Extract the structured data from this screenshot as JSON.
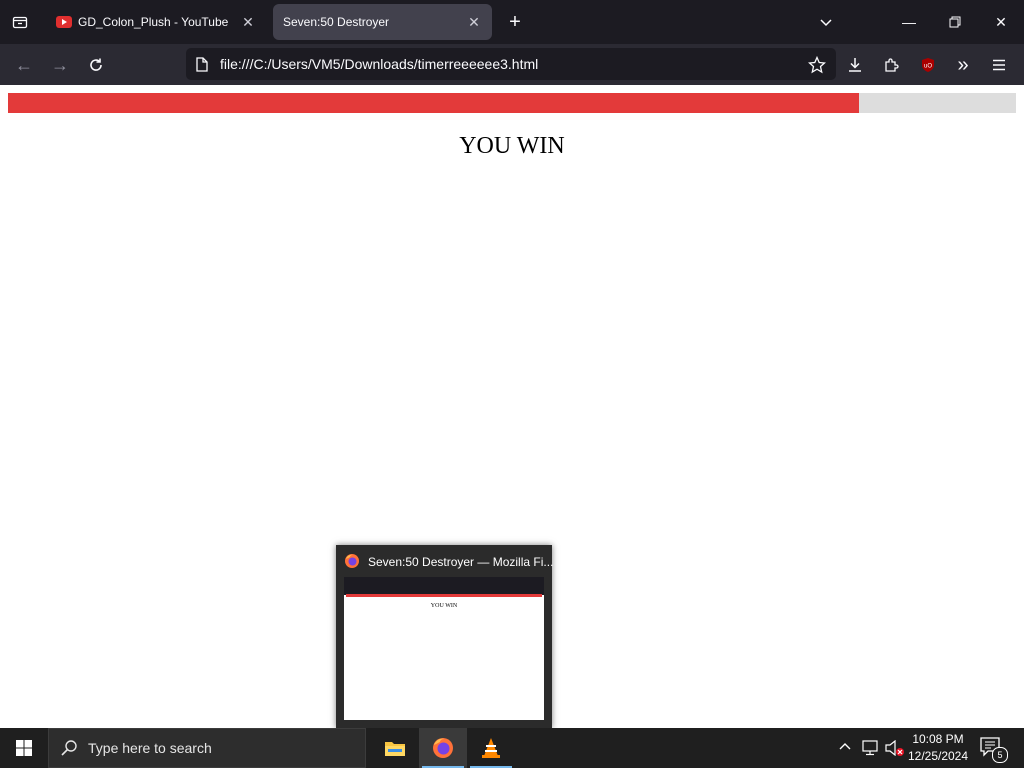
{
  "browser": {
    "tabs": [
      {
        "title": "GD_Colon_Plush - YouTube",
        "active": false,
        "favicon": "youtube-icon"
      },
      {
        "title": "Seven:50 Destroyer",
        "active": true
      }
    ],
    "url": "file:///C:/Users/VM5/Downloads/timerreeeeee3.html"
  },
  "page": {
    "progress": 0.844,
    "progress_color": "#e33a3a",
    "track_color": "#dddddd",
    "message": "YOU WIN"
  },
  "thumbnail": {
    "title": "Seven:50 Destroyer — Mozilla Fi...",
    "preview_message": "YOU WIN"
  },
  "taskbar": {
    "search_placeholder": "Type here to search",
    "time": "10:08 PM",
    "date": "12/25/2024",
    "notification_count": "5"
  }
}
